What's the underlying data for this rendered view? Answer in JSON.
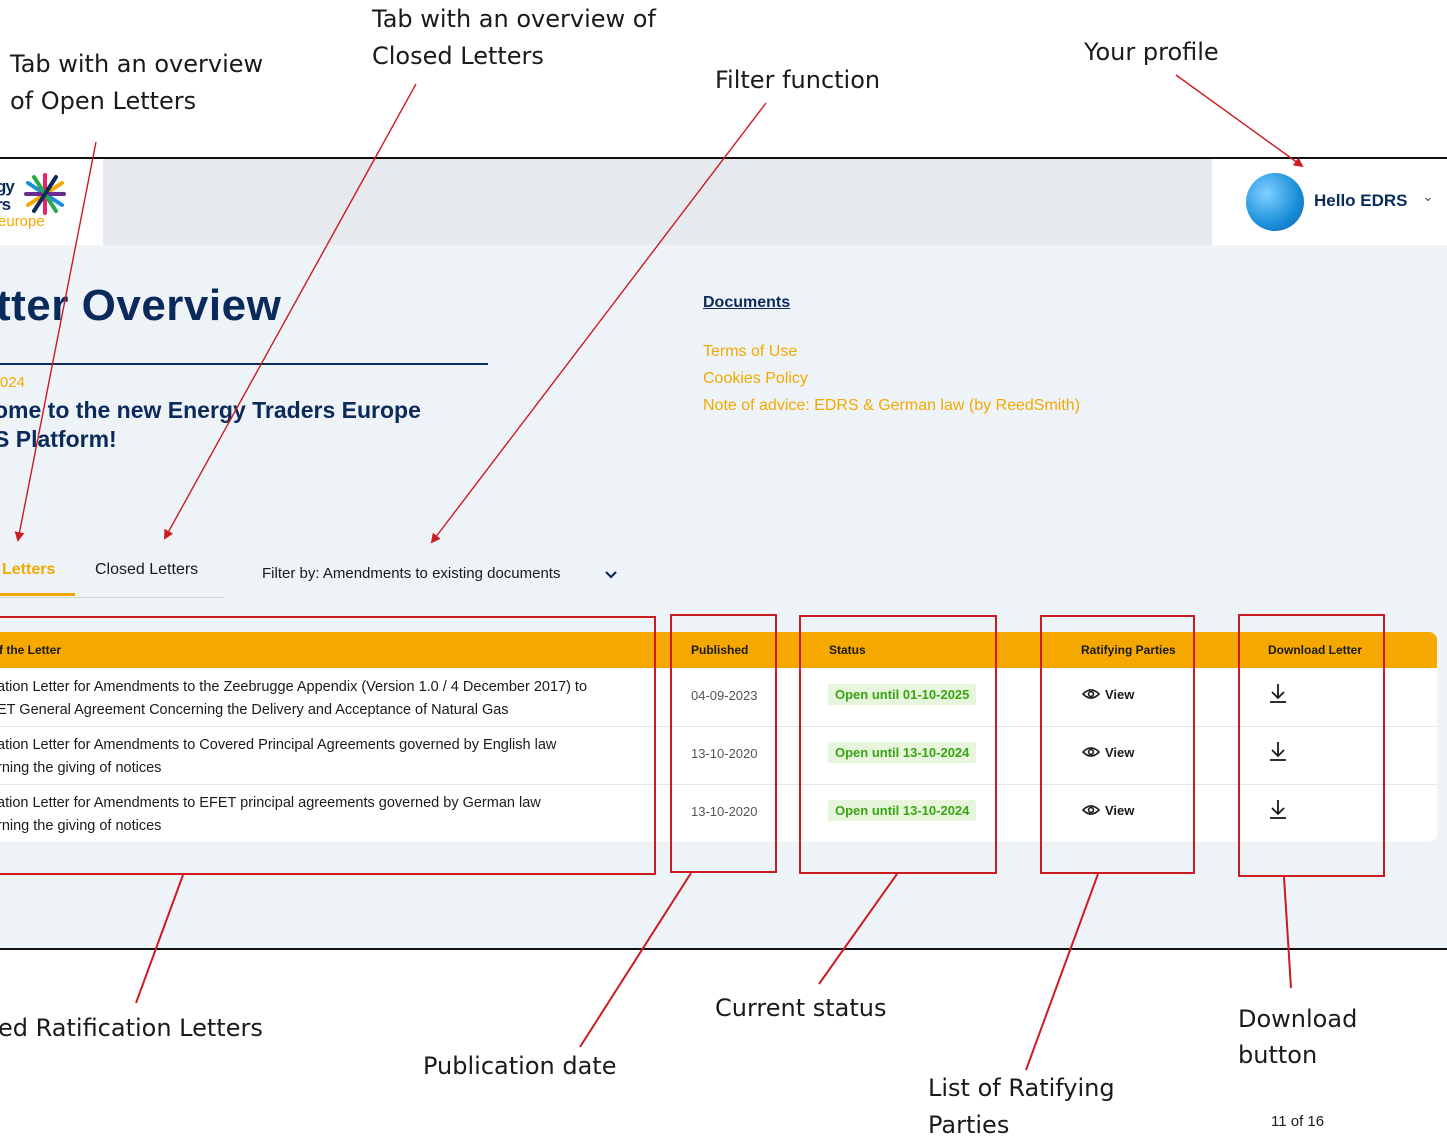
{
  "annotations": {
    "open_tab": [
      "Tab with an overview",
      "of Open Letters"
    ],
    "closed_tab": [
      "Tab with an overview of",
      "Closed Letters"
    ],
    "filter": "Filter function",
    "profile": "Your profile",
    "letters": "ed Ratification Letters",
    "published": "Publication date",
    "status": "Current status",
    "parties": [
      "List of Ratifying",
      "Parties"
    ],
    "download": [
      "Download",
      "button"
    ]
  },
  "logo": {
    "line1": "gy",
    "line2": "rs",
    "line3": "europe"
  },
  "profile": {
    "greeting": "Hello EDRS",
    "chevron": "⌄"
  },
  "page": {
    "title": "tter Overview",
    "news_date": "024",
    "news_title_1": "ome to the new Energy Traders Europe",
    "news_title_2": "S Platform!"
  },
  "links": {
    "documents": "Documents",
    "items": [
      "Terms of Use",
      "Cookies Policy",
      "Note of advice: EDRS & German law (by ReedSmith)"
    ]
  },
  "tabs": {
    "open": "Letters",
    "closed": "Closed Letters"
  },
  "filter": {
    "label": "Filter by: Amendments to existing documents"
  },
  "table": {
    "headers": [
      "f the Letter",
      "Published",
      "Status",
      "Ratifying Parties",
      "Download Letter"
    ],
    "rows": [
      {
        "line1": "ation Letter for Amendments to the Zeebrugge Appendix (Version 1.0 / 4 December 2017) to",
        "line2": "ET General Agreement Concerning the Delivery and Acceptance of Natural Gas",
        "published": "04-09-2023",
        "status": "Open until 01-10-2025",
        "view": "View"
      },
      {
        "line1": "ation Letter for Amendments to Covered Principal Agreements governed by English law",
        "line2": "rning the giving of notices",
        "published": "13-10-2020",
        "status": "Open until 13-10-2024",
        "view": "View"
      },
      {
        "line1": "ation Letter for Amendments to EFET principal agreements governed by German law",
        "line2": "rning the giving of notices",
        "published": "13-10-2020",
        "status": "Open until 13-10-2024",
        "view": "View"
      }
    ]
  },
  "footer": {
    "page": "11 of 16"
  },
  "colors": {
    "navy": "#0b2a5c",
    "orange": "#f5a800",
    "red": "#cc1b22",
    "green": "#3aa415"
  },
  "icons": [
    "chevron-down-icon",
    "eye-icon",
    "download-icon",
    "logo-star-icon"
  ]
}
